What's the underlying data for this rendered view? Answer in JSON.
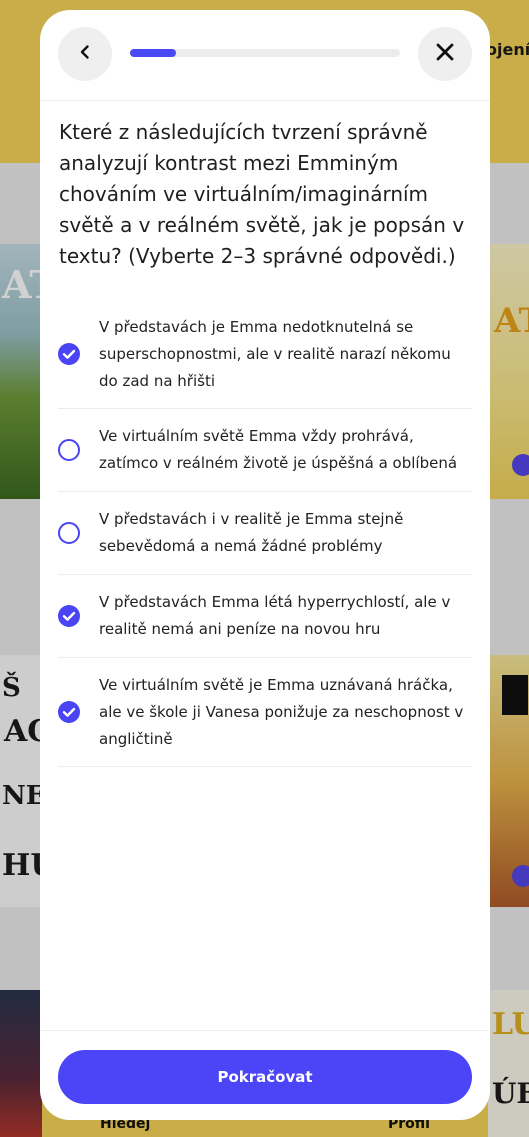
{
  "background": {
    "top_right_text": "ojení",
    "nav": {
      "search_label": "Hledej",
      "profile_label": "Profil"
    }
  },
  "progress": {
    "value": 0.17,
    "color": "#4a4af4"
  },
  "question": "Které z následujících tvrzení správně analyzují kontrast mezi Emminým chováním ve virtuálním/imaginárním světě a v reálném světě, jak je popsán v textu? (Vyberte 2–3 správné odpovědi.)",
  "options": [
    {
      "text": "V představách je Emma nedotknutelná se superschopnostmi, ale v realitě narazí někomu do zad na hřišti",
      "checked": true
    },
    {
      "text": "Ve virtuálním světě Emma vždy prohrává, zatímco v reálném životě je úspěšná a oblíbená",
      "checked": false
    },
    {
      "text": "V představách i v realitě je Emma stejně sebevědomá a nemá žádné problémy",
      "checked": false
    },
    {
      "text": "V představách Emma létá hyperrychlostí, ale v realitě nemá ani peníze na novou hru",
      "checked": true
    },
    {
      "text": "Ve virtuálním světě je Emma uznávaná hráčka, ale ve škole ji Vanesa ponižuje za neschopnost v angličtině",
      "checked": true
    }
  ],
  "cta": {
    "label": "Pokračovat",
    "color": "#4b45f7"
  },
  "icons": {
    "back": "chevron-left-icon",
    "close": "close-icon",
    "checked": "checkmark-circle-icon",
    "unchecked": "empty-circle-icon"
  }
}
